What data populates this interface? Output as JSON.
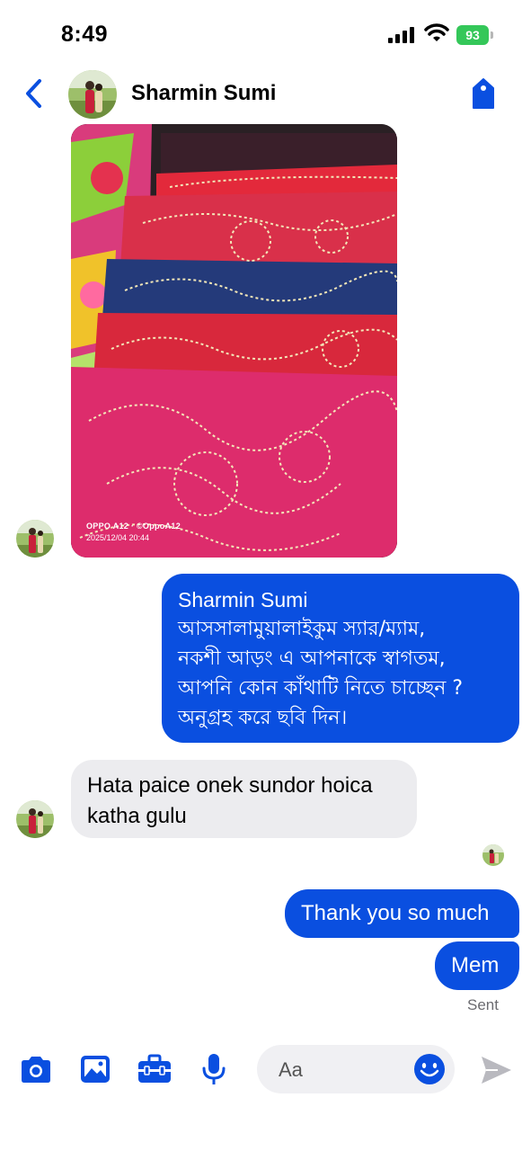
{
  "status_bar": {
    "time": "8:49",
    "battery": "93"
  },
  "header": {
    "contact_name": "Sharmin Sumi"
  },
  "photo_message": {
    "caption_device": "OPPO A12 · ©OppoA12",
    "caption_datetime": "2025/12/04 20:44"
  },
  "messages": [
    {
      "direction": "out",
      "lines": [
        "Sharmin Sumi",
        "আসসালামুয়ালাইকুম স্যার/ম্যাম,",
        "নকশী আড়ং এ আপনাকে স্বাগতম,",
        "আপনি কোন কাঁথাটি নিতে চাচ্ছেন ?",
        "অনুগ্রহ করে ছবি দিন।"
      ]
    },
    {
      "direction": "in",
      "text": "Hata paice onek sundor hoica katha gulu"
    },
    {
      "direction": "out",
      "text": "Thank you so much"
    },
    {
      "direction": "out",
      "text": "Mem"
    }
  ],
  "delivery_status": "Sent",
  "composer": {
    "placeholder": "Aa"
  },
  "colors": {
    "accent": "#0a4fe0",
    "incoming_bubble": "#ececef",
    "battery": "#34c759"
  },
  "icons": [
    "back-chevron-icon",
    "tag-icon",
    "camera-icon",
    "image-icon",
    "toolbox-icon",
    "microphone-icon",
    "emoji-icon",
    "send-icon"
  ]
}
